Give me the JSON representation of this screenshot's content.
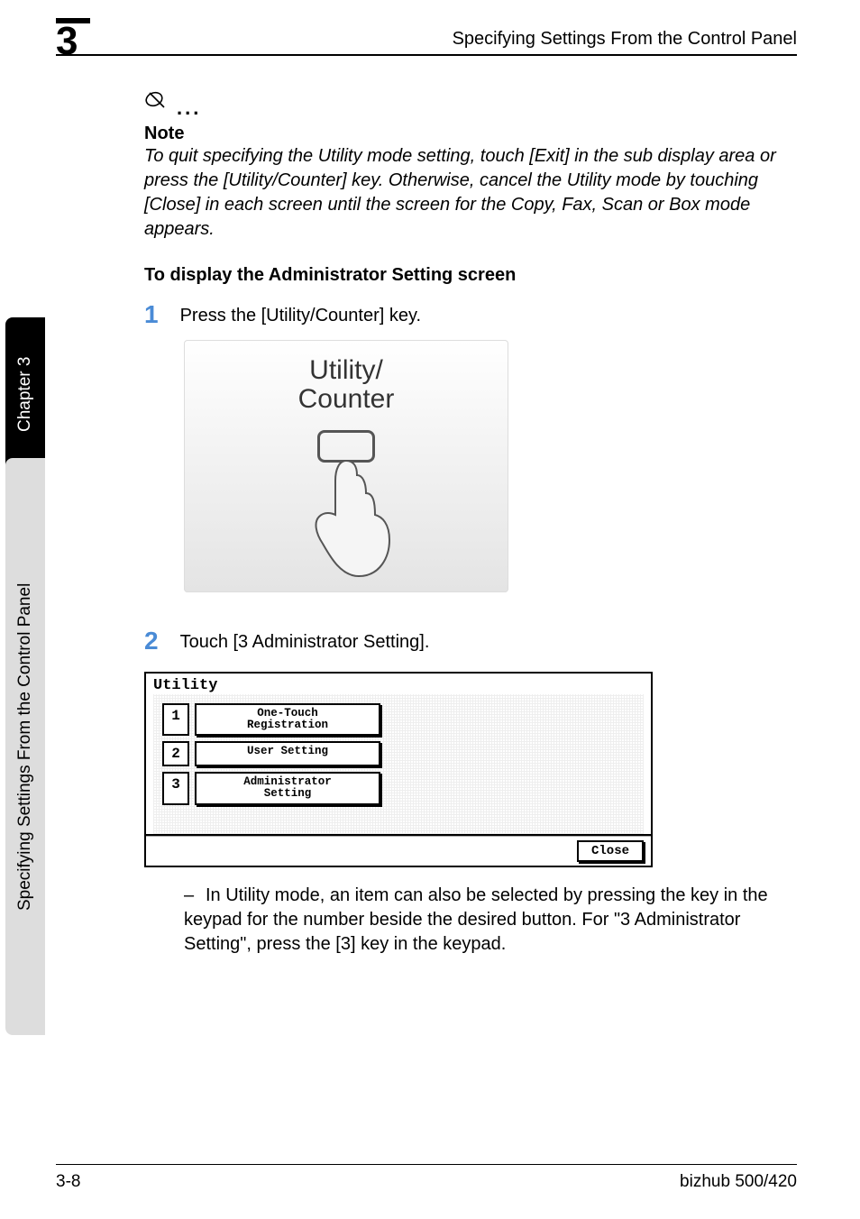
{
  "chapterNumber": "3",
  "headerTitle": "Specifying Settings From the Control Panel",
  "sideTabDark": "Chapter 3",
  "sideTabLight": "Specifying Settings From the Control Panel",
  "note": {
    "heading": "Note",
    "body": "To quit specifying the Utility mode setting, touch [Exit] in the sub display area or press the [Utility/Counter] key. Otherwise, cancel the Utility mode by touching [Close] in each screen until the screen for the Copy, Fax, Scan or Box mode appears."
  },
  "subheading": "To display the Administrator Setting screen",
  "steps": {
    "s1": {
      "num": "1",
      "text": "Press the [Utility/Counter] key."
    },
    "s2": {
      "num": "2",
      "text": "Touch [3 Administrator Setting]."
    }
  },
  "illus1": {
    "labelLine1": "Utility/",
    "labelLine2": "Counter"
  },
  "utilityScreen": {
    "title": "Utility",
    "rows": [
      {
        "n": "1",
        "label": "One-Touch\nRegistration"
      },
      {
        "n": "2",
        "label": "User Setting"
      },
      {
        "n": "3",
        "label": "Administrator\nSetting"
      }
    ],
    "close": "Close"
  },
  "bulletText": "In Utility mode, an item can also be selected by pressing the key in the keypad for the number beside the desired button. For \"3 Administrator Setting\", press the [3] key in the keypad.",
  "footer": {
    "left": "3-8",
    "right": "bizhub 500/420"
  }
}
